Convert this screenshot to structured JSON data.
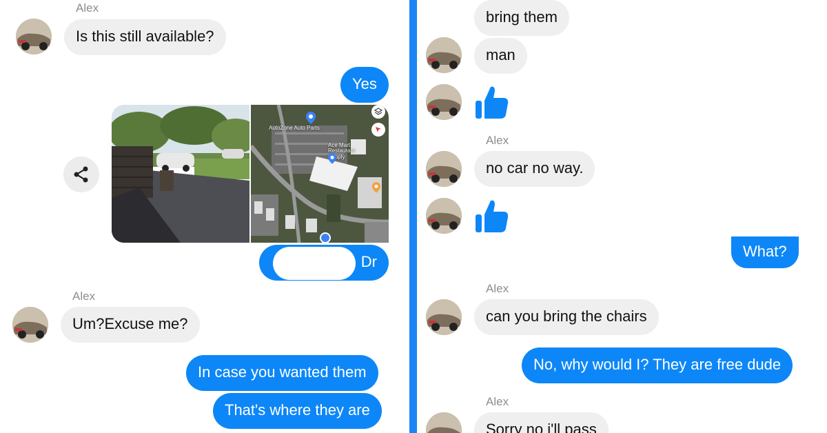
{
  "left": {
    "sender_1": "Alex",
    "msg_in_1": "Is this still available?",
    "msg_out_1": "Yes",
    "map_labels": [
      "AutoZone Auto Parts",
      "Ace Mart Restaurant Supply"
    ],
    "address_suffix": "Dr",
    "sender_2": "Alex",
    "msg_in_2": "Um?Excuse me?",
    "msg_out_2": "In case you wanted them",
    "msg_out_3": "That's where they are"
  },
  "right": {
    "msg_in_1": "bring them",
    "msg_in_2": "man",
    "sender_1": "Alex",
    "msg_in_3": "no car no way.",
    "msg_out_1": "What?",
    "sender_2": "Alex",
    "msg_in_4": "can you bring the chairs",
    "msg_out_2": "No, why would I? They are free dude",
    "sender_3": "Alex",
    "msg_in_5": "Sorry no i'll pass"
  },
  "colors": {
    "outgoing_bubble": "#0d87f7",
    "incoming_bubble": "#efefef",
    "divider": "#1a86f5",
    "thumbs_up": "#0d87f7"
  },
  "icons": [
    "share-icon",
    "thumbs-up-icon",
    "layers-icon",
    "compass-icon",
    "map-pin-icon"
  ]
}
